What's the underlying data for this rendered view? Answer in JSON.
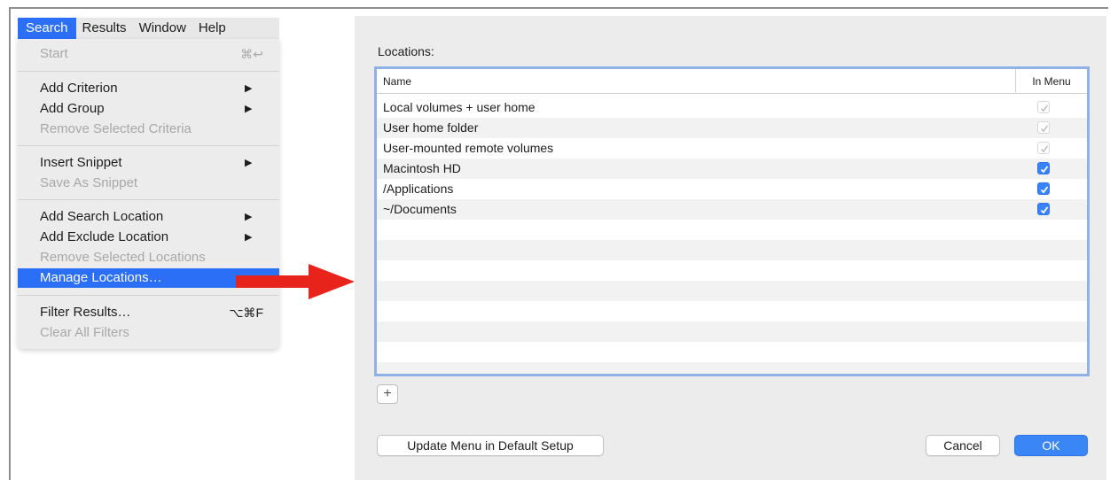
{
  "menubar": {
    "items": [
      {
        "label": "Search"
      },
      {
        "label": "Results"
      },
      {
        "label": "Window"
      },
      {
        "label": "Help"
      }
    ]
  },
  "menu": {
    "start": {
      "label": "Start",
      "shortcut": "⌘↩"
    },
    "add_criterion": {
      "label": "Add Criterion",
      "arrow": "▶"
    },
    "add_group": {
      "label": "Add Group",
      "arrow": "▶"
    },
    "remove_selected_criteria": {
      "label": "Remove Selected Criteria"
    },
    "insert_snippet": {
      "label": "Insert Snippet",
      "arrow": "▶"
    },
    "save_as_snippet": {
      "label": "Save As Snippet"
    },
    "add_search_location": {
      "label": "Add Search Location",
      "arrow": "▶"
    },
    "add_exclude_location": {
      "label": "Add Exclude Location",
      "arrow": "▶"
    },
    "remove_selected_locations": {
      "label": "Remove Selected Locations"
    },
    "manage_locations": {
      "label": "Manage Locations…"
    },
    "filter_results": {
      "label": "Filter Results…",
      "shortcut": "⌥⌘F"
    },
    "clear_all_filters": {
      "label": "Clear All Filters"
    }
  },
  "dialog": {
    "locations_label": "Locations:",
    "columns": {
      "name": "Name",
      "in_menu": "In Menu"
    },
    "rows": [
      {
        "name": "Local volumes + user home",
        "checked": true,
        "enabled": false
      },
      {
        "name": "User home folder",
        "checked": true,
        "enabled": false
      },
      {
        "name": "User-mounted remote volumes",
        "checked": true,
        "enabled": false
      },
      {
        "name": "Macintosh HD",
        "checked": true,
        "enabled": true
      },
      {
        "name": "/Applications",
        "checked": true,
        "enabled": true
      },
      {
        "name": "~/Documents",
        "checked": true,
        "enabled": true
      }
    ],
    "add_button": "+",
    "update_button": "Update Menu in Default Setup",
    "cancel_button": "Cancel",
    "ok_button": "OK"
  },
  "colors": {
    "accent": "#2a6ff6",
    "annotation_arrow": "#e8231c",
    "table_focus_border": "#8fb1e6"
  }
}
